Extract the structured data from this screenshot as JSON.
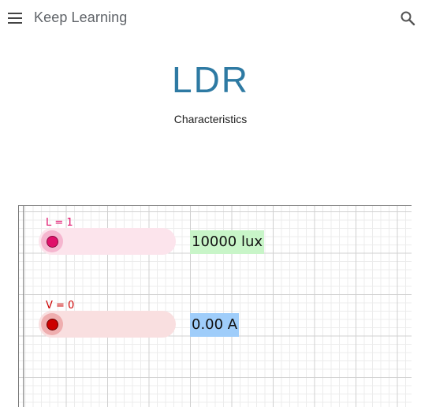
{
  "header": {
    "site_title": "Keep Learning",
    "menu_icon": "hamburger-menu-icon",
    "search_icon": "search-icon"
  },
  "main": {
    "title": "LDR",
    "subtitle": "Characteristics"
  },
  "applet": {
    "light_slider": {
      "label": "L = 1",
      "value": 1,
      "color": "#e0106a",
      "track_color": "#fce4ec",
      "readout": "10000 lux",
      "readout_bg": "#c8f5c8"
    },
    "voltage_slider": {
      "label": "V = 0",
      "value": 0,
      "color": "#cc0000",
      "track_color": "#f9dfe0",
      "readout": "0.00 A",
      "readout_bg": "#9fcdfa"
    }
  },
  "colors": {
    "title": "#2e7aa3",
    "header_text": "#5f6368"
  }
}
